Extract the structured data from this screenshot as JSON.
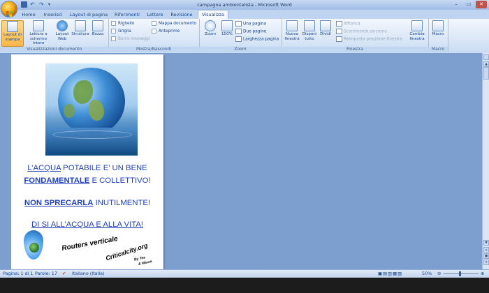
{
  "window": {
    "title": "campagna ambientalista - Microsoft Word"
  },
  "tabs": [
    "Home",
    "Inserisci",
    "Layout di pagina",
    "Riferimenti",
    "Lettere",
    "Revisione",
    "Visualizza"
  ],
  "active_tab": "Visualizza",
  "ribbon": {
    "groups": {
      "views": "Visualizzazioni documento",
      "show_hide": "Mostra/Nascondi",
      "zoom": "Zoom",
      "window": "Finestra",
      "macro": "Macro"
    },
    "views": {
      "print_layout": "Layout di stampa",
      "full_screen": "Lettura a schermo intero",
      "web_layout": "Layout Web",
      "outline": "Struttura",
      "draft": "Bozza"
    },
    "show_hide": {
      "ruler": "Righello",
      "gridlines": "Griglia",
      "message_bar": "Barra messaggi",
      "doc_map": "Mappa documento",
      "thumbnails": "Anteprime"
    },
    "zoom": {
      "zoom": "Zoom",
      "hundred": "100%",
      "one_page": "Una pagina",
      "two_pages": "Due pagine",
      "page_width": "Larghezza pagina"
    },
    "window": {
      "new_window": "Nuova finestra",
      "arrange_all": "Disponi tutto",
      "split": "Dividi",
      "side_by_side": "Affianca",
      "sync_scroll": "Scorrimento sincrono",
      "reset_position": "Reimposta posizione finestra",
      "switch_windows": "Cambia finestra"
    },
    "macro": {
      "macros": "Macro"
    }
  },
  "document": {
    "line1_a": "L’ACQUA",
    "line1_b": " POTABILE E’ UN BENE",
    "line2_a": "FONDAMENTALE",
    "line2_b": " E COLLETTIVO!",
    "line3_a": "NON SPRECARLA",
    "line3_b": " INUTILMENTE!",
    "line4": "DI SI ALL’ACQUA E ALLA VITA!",
    "logo_text1": "Routers verticale",
    "logo_text2": "Criticalcity.org",
    "logo_text3": "By Tea",
    "logo_text4": "& Maura"
  },
  "status": {
    "page": "Pagina: 1 di 1",
    "words": "Parole: 17",
    "language": "Italiano (Italia)",
    "zoom": "50%"
  },
  "colors": {
    "doc_text": "#1f3fbd",
    "ribbon_bg": "#dce8f7",
    "workspace": "#7d9fcf"
  }
}
